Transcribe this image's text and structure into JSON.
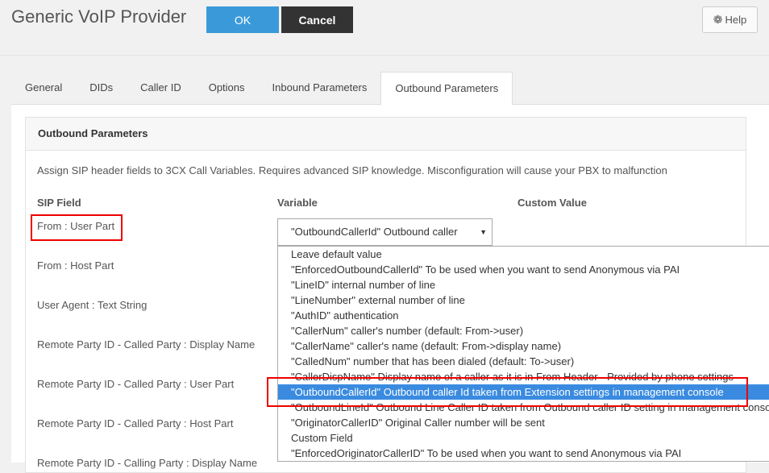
{
  "header": {
    "title": "Generic VoIP Provider",
    "ok_label": "OK",
    "cancel_label": "Cancel",
    "help_label": "Help"
  },
  "tabs": [
    {
      "label": "General"
    },
    {
      "label": "DIDs"
    },
    {
      "label": "Caller ID"
    },
    {
      "label": "Options"
    },
    {
      "label": "Inbound Parameters"
    },
    {
      "label": "Outbound Parameters",
      "active": true
    }
  ],
  "panel": {
    "heading": "Outbound Parameters",
    "description": "Assign SIP header fields to 3CX Call Variables. Requires advanced SIP knowledge. Misconfiguration will cause your PBX to malfunction",
    "columns": {
      "sip_field": "SIP Field",
      "variable": "Variable",
      "custom_value": "Custom Value"
    },
    "rows": [
      {
        "label": "From : User Part"
      },
      {
        "label": "From : Host Part"
      },
      {
        "label": "User Agent : Text String"
      },
      {
        "label": "Remote Party ID - Called Party : Display Name"
      },
      {
        "label": "Remote Party ID - Called Party : User Part"
      },
      {
        "label": "Remote Party ID - Called Party : Host Part"
      },
      {
        "label": "Remote Party ID - Calling Party : Display Name"
      }
    ]
  },
  "select": {
    "value": "\"OutboundCallerId\" Outbound caller"
  },
  "dropdown": {
    "options": [
      "Leave default value",
      "\"EnforcedOutboundCallerId\" To be used when you want to send Anonymous via PAI",
      "\"LineID\" internal number of line",
      "\"LineNumber\" external number of line",
      "\"AuthID\" authentication",
      "\"CallerNum\" caller's number (default: From->user)",
      "\"CallerName\" caller's name (default: From->display name)",
      "\"CalledNum\" number that has been dialed (default: To->user)",
      "\"CallerDispName\" Display name of a caller as it is in From Header - Provided by phone settings",
      "\"OutboundCallerId\" Outbound caller Id taken from Extension settings in management console",
      "\"OutboundLineId\" Outbound Line Caller ID taken from Outbound caller ID setting in management console",
      "\"OriginatorCallerID\" Original Caller number will be sent",
      "Custom Field",
      "\"EnforcedOriginatorCallerID\" To be used when you want to send Anonymous via PAI"
    ],
    "selected_index": 9
  }
}
